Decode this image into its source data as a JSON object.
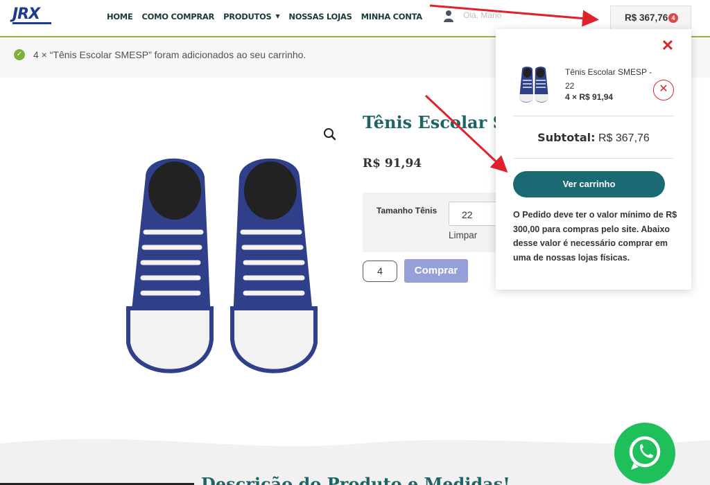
{
  "header": {
    "logo_text": "JRX",
    "nav": [
      "HOME",
      "COMO COMPRAR",
      "PRODUTOS",
      "NOSSAS LOJAS",
      "MINHA CONTA"
    ],
    "greeting": "Olá, Mario",
    "cart_total": "R$ 367,76",
    "cart_count": "4"
  },
  "notice": {
    "text": "4 × “Tênis Escolar SMESP” foram adicionados ao seu carrinho."
  },
  "product": {
    "title": "Tênis Escolar S",
    "price": "R$ 91,94",
    "variation_label": "Tamanho Tênis",
    "variation_value": "22",
    "clear_label": "Limpar",
    "quantity": "4",
    "buy_label": "Comprar"
  },
  "mini_cart": {
    "item_name": "Tênis Escolar SMESP - 22",
    "item_qty": "4 × R$ 91,94",
    "subtotal_label": "Subtotal:",
    "subtotal_value": "R$ 367,76",
    "view_cart_label": "Ver carrinho",
    "note": "O Pedido deve ter o valor mínimo de R$ 300,00 para compras pelo site. Abaixo desse valor é necessário comprar em uma de nossas lojas físicas."
  },
  "description": {
    "heading": "Descrição do Produto e Medidas!"
  },
  "colors": {
    "accent_green": "#8fb43a",
    "teal": "#1a6a74",
    "title_teal": "#1e6366",
    "buy_button": "#979fd9",
    "remove_red": "#d8262c",
    "whatsapp": "#1fbf5b"
  },
  "icons": [
    "user-icon",
    "search-icon",
    "close-icon",
    "remove-circle-icon",
    "check-icon",
    "whatsapp-icon",
    "chevron-down-icon"
  ]
}
